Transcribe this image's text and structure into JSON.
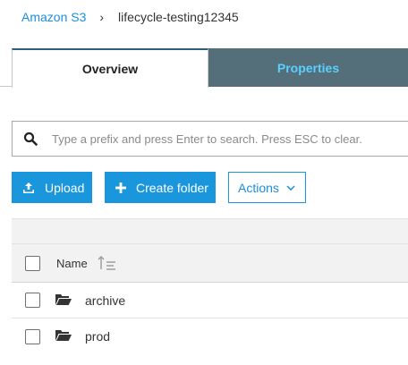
{
  "breadcrumb": {
    "root": "Amazon S3",
    "separator": "›",
    "current": "lifecycle-testing12345"
  },
  "tabs": [
    {
      "label": "Overview",
      "active": true
    },
    {
      "label": "Properties",
      "active": false
    }
  ],
  "search": {
    "value": "",
    "placeholder": "Type a prefix and press Enter to search. Press ESC to clear."
  },
  "toolbar": {
    "upload_label": "Upload",
    "create_folder_label": "Create folder",
    "actions_label": "Actions"
  },
  "table": {
    "columns": [
      {
        "label": "Name",
        "sortable": true
      }
    ],
    "rows": [
      {
        "name": "archive",
        "type": "folder",
        "checked": false
      },
      {
        "name": "prod",
        "type": "folder",
        "checked": false
      }
    ]
  },
  "icons": {
    "search": "search-icon",
    "upload": "upload-icon",
    "create_folder": "plus-icon",
    "actions": "chevron-down-icon",
    "sort": "sort-icon",
    "folder": "folder-icon"
  },
  "colors": {
    "link": "#1a8ee0",
    "primary_button": "#1a96dd",
    "inactive_tab_bg": "#546e7a",
    "inactive_tab_text": "#5ad0ff"
  }
}
